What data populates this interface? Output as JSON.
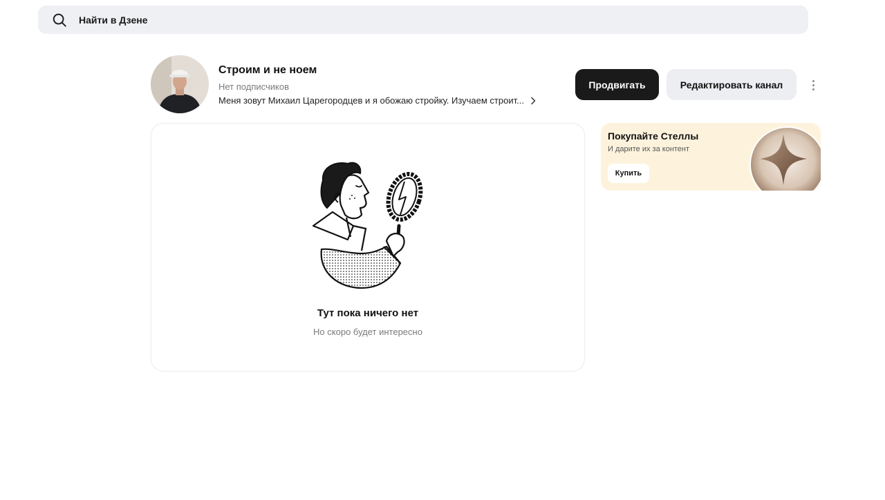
{
  "search": {
    "placeholder": "Найти в Дзене"
  },
  "channel": {
    "title": "Строим и не ноем",
    "subscribers": "Нет подписчиков",
    "description": "Меня зовут Михаил Царегородцев и я обожаю стройку. Изучаем строит..."
  },
  "actions": {
    "promote": "Продвигать",
    "edit": "Редактировать канал"
  },
  "empty": {
    "title": "Тут пока ничего нет",
    "subtitle": "Но скоро будет интересно"
  },
  "promo": {
    "title": "Покупайте Стеллы",
    "subtitle": "И дарите их за контент",
    "button": "Купить"
  },
  "colors": {
    "primary_button": "#1a1a1a",
    "secondary_button": "#eceef1",
    "promo_bg": "#fdf3dd",
    "search_bg": "#eef0f3"
  }
}
